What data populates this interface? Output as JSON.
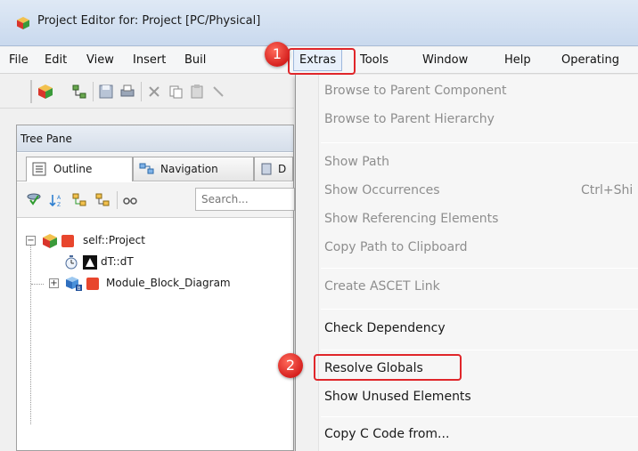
{
  "window": {
    "title": "Project Editor for: Project [PC/Physical]"
  },
  "menubar": {
    "items": [
      "File",
      "Edit",
      "View",
      "Insert",
      "Buil",
      "Extras",
      "Tools",
      "Window",
      "Help",
      "Operating"
    ]
  },
  "tree_pane": {
    "title": "Tree Pane",
    "tabs": [
      "Outline",
      "Navigation",
      "D"
    ],
    "search_placeholder": "Search...",
    "nodes": [
      "self::Project",
      "dT::dT",
      "Module_Block_Diagram"
    ]
  },
  "extras_menu": {
    "items": [
      {
        "label": "Browse to Parent Component",
        "enabled": false
      },
      {
        "label": "Browse to Parent Hierarchy",
        "enabled": false
      },
      {
        "label": "Show Path",
        "enabled": false
      },
      {
        "label": "Show Occurrences",
        "enabled": false,
        "shortcut": "Ctrl+Shi"
      },
      {
        "label": "Show Referencing Elements",
        "enabled": false
      },
      {
        "label": "Copy Path to Clipboard",
        "enabled": false
      },
      {
        "label": "Create ASCET Link",
        "enabled": false
      },
      {
        "label": "Check Dependency",
        "enabled": true
      },
      {
        "label": "Resolve Globals",
        "enabled": true
      },
      {
        "label": "Show Unused Elements",
        "enabled": true
      },
      {
        "label": "Copy C Code from...",
        "enabled": true
      }
    ]
  },
  "annotations": {
    "badge1": "1",
    "badge2": "2"
  },
  "colors": {
    "highlight": "#e0262a",
    "badge": "#d6211f",
    "disabled_text": "#8e8e8e"
  }
}
